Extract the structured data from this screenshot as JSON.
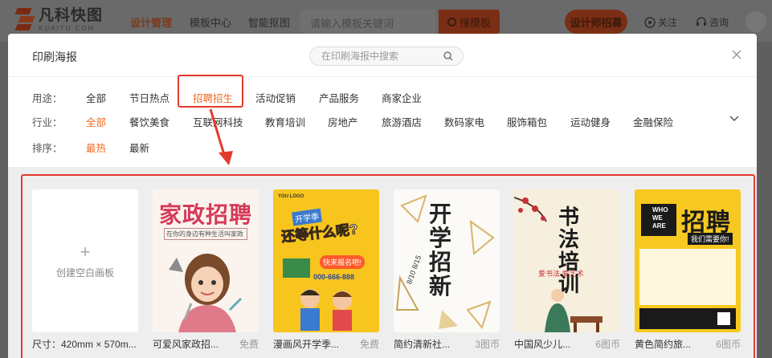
{
  "nav": {
    "logo_text": "凡科快图",
    "logo_sub": "KUAITU.COM",
    "items": [
      "设计管理",
      "模板中心",
      "智能抠图"
    ],
    "search_placeholder": "请输入模板关键词",
    "search_button": "搜模板",
    "design_button": "设计师招募",
    "follow": "关注",
    "consult": "咨询"
  },
  "modal": {
    "title": "印刷海报",
    "search_placeholder": "在印刷海报中搜索",
    "filters": {
      "usage": {
        "label": "用途：",
        "options": [
          "全部",
          "节日热点",
          "招聘招生",
          "活动促销",
          "产品服务",
          "商家企业"
        ]
      },
      "industry": {
        "label": "行业：",
        "options": [
          "全部",
          "餐饮美食",
          "互联网科技",
          "教育培训",
          "房地产",
          "旅游酒店",
          "数码家电",
          "服饰箱包",
          "运动健身",
          "金融保险"
        ]
      },
      "sort": {
        "label": "排序：",
        "options": [
          "最热",
          "最新"
        ]
      }
    },
    "cards": [
      {
        "name": "创建空白画板",
        "caption": "尺寸：420mm × 570m..."
      },
      {
        "name": "可爱风家政招...",
        "price": "免费",
        "poster_title": "家政招聘",
        "poster_sub": "在你的身边有种生活叫家政"
      },
      {
        "name": "漫画风开学季...",
        "price": "免费",
        "poster_title": "开学季",
        "poster_sub": "还等什么呢?",
        "poster_btn": "快来报名吧!",
        "poster_phone": "000-666-888",
        "poster_logo": "YOU LOGO"
      },
      {
        "name": "简约清新社...",
        "price": "3图币",
        "poster_title": "开学招新",
        "poster_date": "8/10 8/15"
      },
      {
        "name": "中国风少儿...",
        "price": "6图币",
        "poster_title": "书法培训",
        "poster_sub": "爱书法 爱艺术"
      },
      {
        "name": "黄色简约旅...",
        "price": "6图币",
        "poster_title": "招聘",
        "poster_who": "WHO WE ARE",
        "poster_sub": "我们需要你!"
      }
    ]
  },
  "colors": {
    "accent": "#f06a22",
    "annotation_red": "#e23a2e"
  }
}
